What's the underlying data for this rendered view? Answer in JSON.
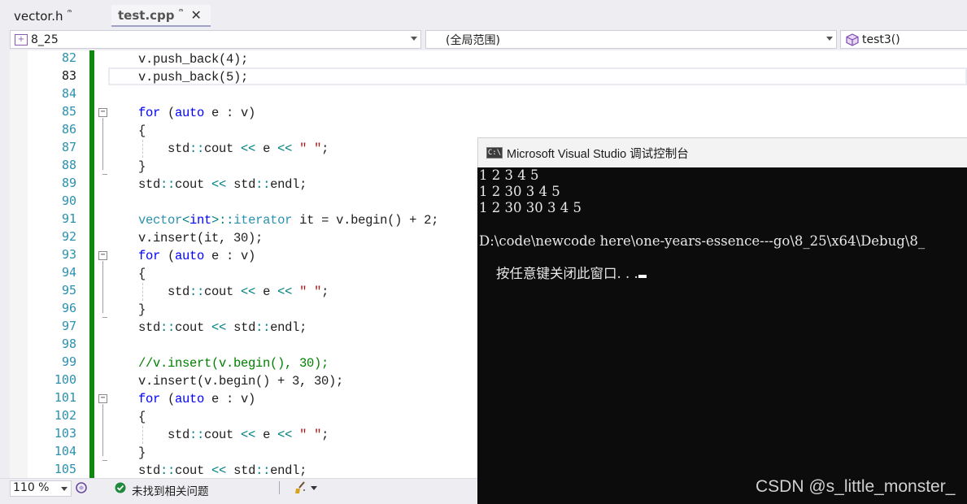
{
  "tabs": [
    {
      "label": "vector.h",
      "pin": "ᩨ"
    },
    {
      "label": "test.cpp",
      "pin": "ᩨ",
      "close": "✕"
    }
  ],
  "navbar": {
    "project": "8_25",
    "scope": "(全局范围)",
    "member": "test3()"
  },
  "editor": {
    "current_line": "83",
    "line_numbers": [
      "82",
      "83",
      "84",
      "85",
      "86",
      "87",
      "88",
      "89",
      "90",
      "91",
      "92",
      "93",
      "94",
      "95",
      "96",
      "97",
      "98",
      "99",
      "100",
      "101",
      "102",
      "103",
      "104",
      "105"
    ],
    "lines": [
      "v.push_back(4);",
      "v.push_back(5);",
      "",
      "for (auto e : v)",
      "{",
      "std::cout << e << \" \";",
      "}",
      "std::cout << std::endl;",
      "",
      "vector<int>::iterator it = v.begin() + 2;",
      "v.insert(it, 30);",
      "for (auto e : v)",
      "{",
      "std::cout << e << \" \";",
      "}",
      "std::cout << std::endl;",
      "",
      "//v.insert(v.begin(), 30);",
      "v.insert(v.begin() + 3, 30);",
      "for (auto e : v)",
      "{",
      "std::cout << e << \" \";",
      "}",
      "std::cout << std::endl;"
    ]
  },
  "statusbar": {
    "zoom": "110 %",
    "issues": "未找到相关问题"
  },
  "console": {
    "icon_text": "C:\\",
    "title": "Microsoft Visual Studio 调试控制台",
    "output": [
      "1 2 3 4 5",
      "1 2 30 3 4 5",
      "1 2 30 30 3 4 5",
      "",
      "D:\\code\\newcode here\\one-years-essence---go\\8_25\\x64\\Debug\\8_",
      "按任意键关闭此窗口. . ."
    ]
  },
  "watermark": "CSDN @s_little_monster_"
}
